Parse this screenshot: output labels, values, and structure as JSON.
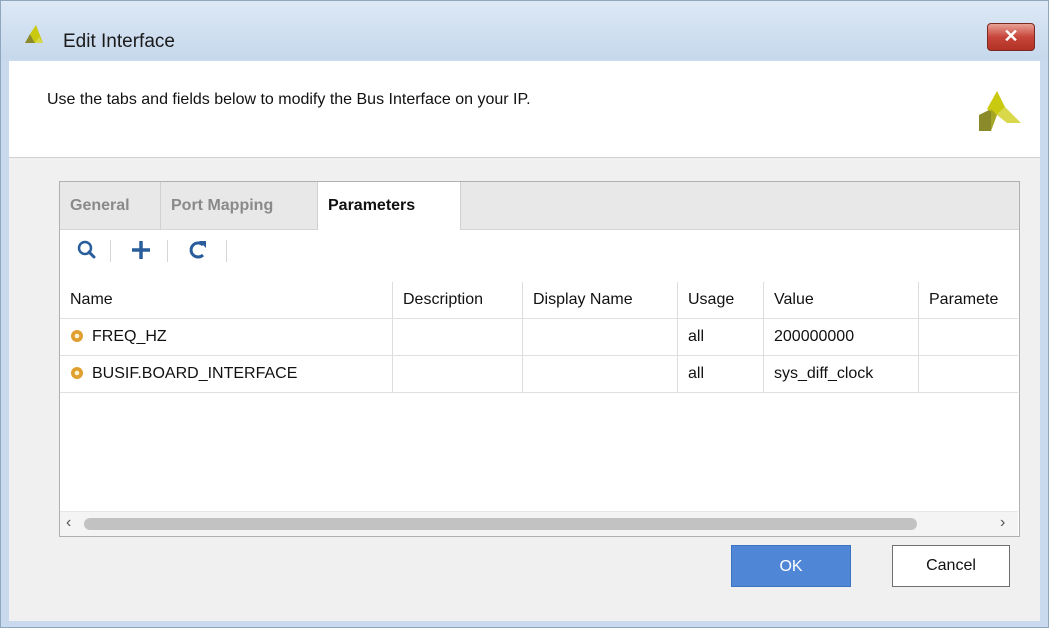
{
  "window": {
    "title": "Edit Interface",
    "close_label": "✕"
  },
  "header": {
    "instructions": "Use the tabs and fields below to modify the Bus Interface on your IP."
  },
  "tabs": [
    {
      "label": "General",
      "active": false
    },
    {
      "label": "Port Mapping",
      "active": false
    },
    {
      "label": "Parameters",
      "active": true
    }
  ],
  "toolbar": {
    "icons": [
      "search-icon",
      "add-icon",
      "refresh-icon"
    ]
  },
  "table": {
    "columns": [
      "Name",
      "Description",
      "Display Name",
      "Usage",
      "Value",
      "Paramete"
    ],
    "rows": [
      {
        "name": "FREQ_HZ",
        "description": "",
        "display_name": "",
        "usage": "all",
        "value": "200000000",
        "parameter": ""
      },
      {
        "name": "BUSIF.BOARD_INTERFACE",
        "description": "",
        "display_name": "",
        "usage": "all",
        "value": "sys_diff_clock",
        "parameter": ""
      }
    ]
  },
  "scrollbar": {
    "left_arrow": "‹",
    "right_arrow": "›"
  },
  "buttons": {
    "ok": "OK",
    "cancel": "Cancel"
  },
  "colors": {
    "accent": "#4f87d6",
    "logo_yellow": "#c9c90f",
    "logo_olive": "#8a8a2a",
    "gear_orange": "#e0a030"
  }
}
